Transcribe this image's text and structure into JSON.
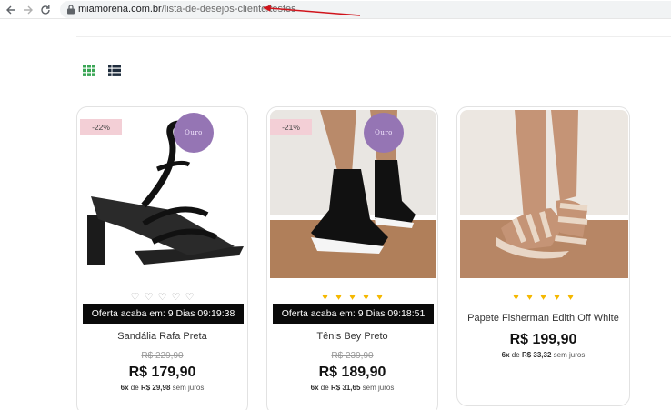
{
  "browser": {
    "url_domain": "miamorena.com.br",
    "url_path": "/lista-de-desejos-cliente/testes"
  },
  "view_toggles": {
    "grid_icon": "grid-icon",
    "list_icon": "list-icon",
    "active_color": "#3aa655"
  },
  "products": [
    {
      "discount": "-22%",
      "brand_logo_text": "Ouro",
      "rating": 0,
      "offer_text": "Oferta acaba em: 9 Dias 09:19:38",
      "name": "Sandália Rafa Preta",
      "old_price": "R$ 229,90",
      "price": "R$ 179,90",
      "installments_count": "6x",
      "installments_de": "de",
      "installments_value": "R$ 29,98",
      "installments_note": "sem juros"
    },
    {
      "discount": "-21%",
      "brand_logo_text": "Ouro",
      "rating": 5,
      "offer_text": "Oferta acaba em: 9 Dias 09:18:51",
      "name": "Tênis Bey Preto",
      "old_price": "R$ 239,90",
      "price": "R$ 189,90",
      "installments_count": "6x",
      "installments_de": "de",
      "installments_value": "R$ 31,65",
      "installments_note": "sem juros"
    },
    {
      "rating": 5,
      "name": "Papete Fisherman Edith Off White",
      "price": "R$ 199,90",
      "installments_count": "6x",
      "installments_de": "de",
      "installments_value": "R$ 33,32",
      "installments_note": "sem juros"
    }
  ],
  "colors": {
    "star": "#f5b800",
    "offer_bar": "#0a0a0a",
    "discount_bg": "#f3cfd6",
    "brand_logo": "#9575b4",
    "arrow": "#d0141c"
  }
}
